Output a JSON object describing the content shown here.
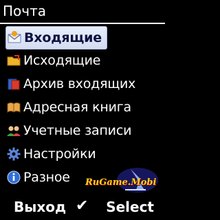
{
  "header": {
    "title": "Почта"
  },
  "menu": {
    "items": [
      {
        "label": "Входящие",
        "icon": "inbox-icon",
        "selected": true
      },
      {
        "label": "Исходящие",
        "icon": "outbox-folder-icon"
      },
      {
        "label": "Архив входящих",
        "icon": "archive-icon"
      },
      {
        "label": "Адресная книга",
        "icon": "address-book-icon"
      },
      {
        "label": "Учетные записи",
        "icon": "accounts-icon"
      },
      {
        "label": "Настройки",
        "icon": "gear-icon"
      },
      {
        "label": "Разное",
        "icon": "info-icon"
      }
    ]
  },
  "watermark": {
    "text": "RuGame.Mobi"
  },
  "softkeys": {
    "left": "Выход",
    "center": "✔",
    "right": "Select"
  },
  "colors": {
    "background": "#000000",
    "text": "#ffffff",
    "selection": "#e3e9f7",
    "watermark": "#ffd21a"
  }
}
